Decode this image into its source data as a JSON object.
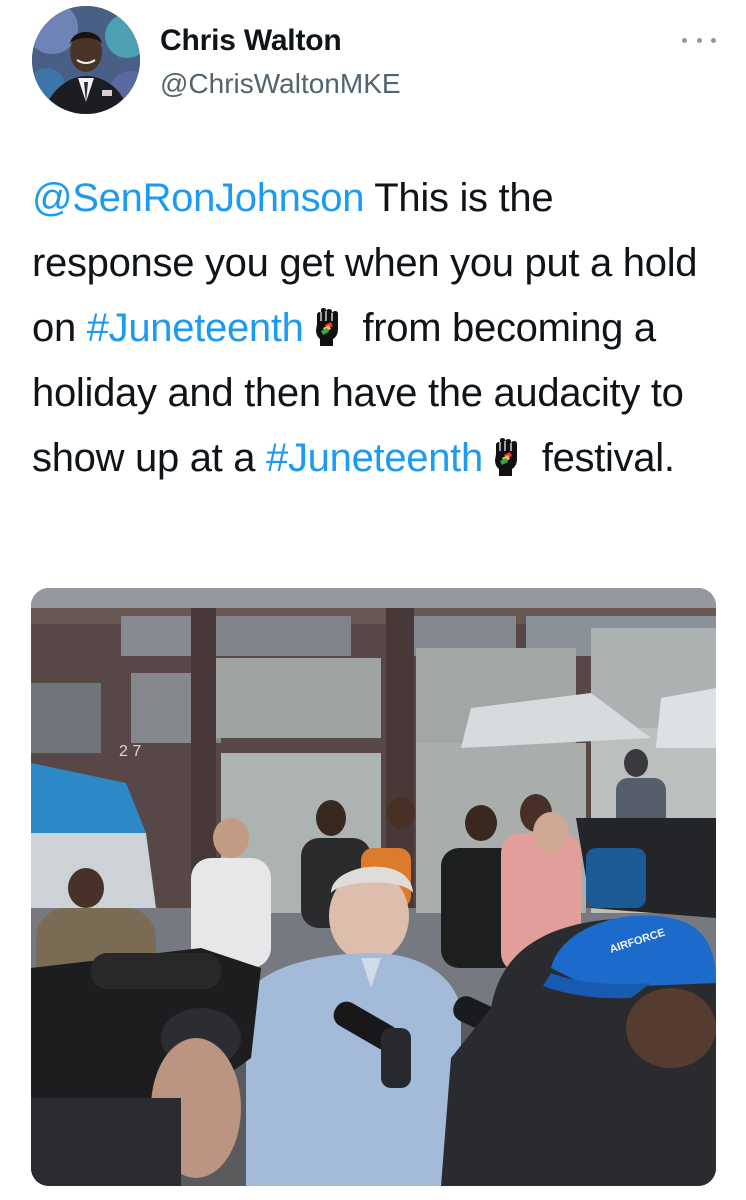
{
  "author": {
    "display_name": "Chris Walton",
    "handle": "@ChrisWaltonMKE",
    "avatar_icon": "profile-photo"
  },
  "menu": {
    "icon": "more-horizontal-icon"
  },
  "tweet": {
    "mention": "@SenRonJohnson",
    "text_1": " This is the response you get when you put a hold on ",
    "hashtag_1": "#Juneteenth",
    "text_2": " from becoming a holiday and then have the audacity to show up at a ",
    "hashtag_2": "#Juneteenth",
    "text_3": " festival.",
    "emoji_icon": "raised-fist-emoji"
  },
  "media": {
    "type": "video-frame",
    "building_number": "2 7",
    "hat_text": "AIRFORCE"
  },
  "colors": {
    "link": "#1d9bf0",
    "text": "#0f1419",
    "secondary": "#536471"
  }
}
